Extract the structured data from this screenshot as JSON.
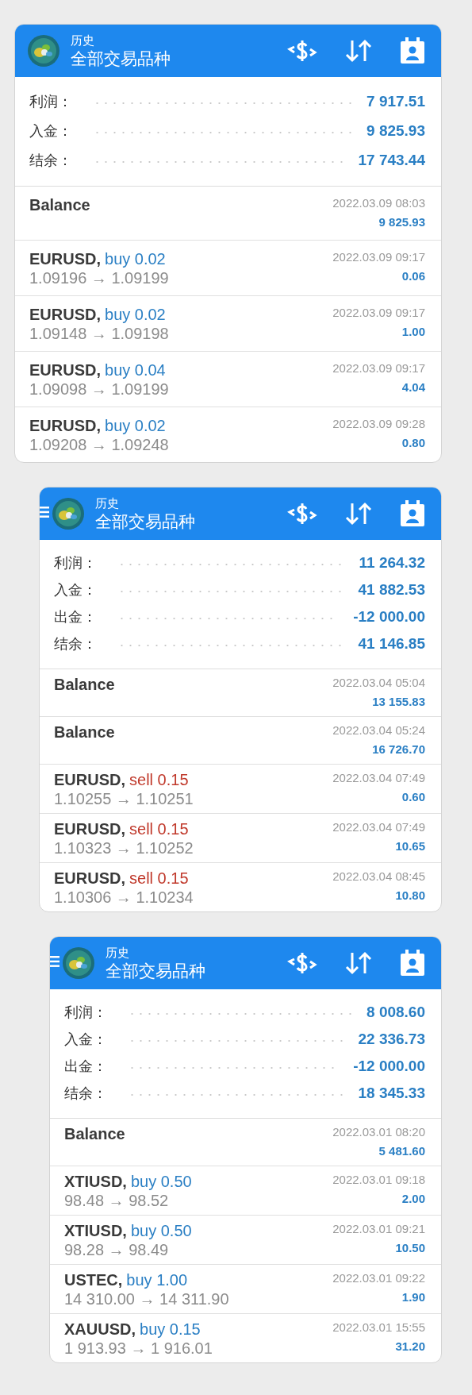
{
  "screens": [
    {
      "header": {
        "title": "历史",
        "subtitle": "全部交易品种",
        "menu_button": false
      },
      "summary": [
        {
          "label": "利润：",
          "value": "7 917.51"
        },
        {
          "label": "入金：",
          "value": "9 825.93"
        },
        {
          "label": "结余：",
          "value": "17 743.44"
        }
      ],
      "deals": [
        {
          "kind": "balance",
          "symbol": "Balance",
          "time": "2022.03.09 08:03",
          "profit": "9 825.93"
        },
        {
          "kind": "trade",
          "symbol": "EURUSD,",
          "side": "buy",
          "size": "0.02",
          "prices": "1.09196 → 1.09199",
          "time": "2022.03.09 09:17",
          "profit": "0.06"
        },
        {
          "kind": "trade",
          "symbol": "EURUSD,",
          "side": "buy",
          "size": "0.02",
          "prices": "1.09148 → 1.09198",
          "time": "2022.03.09 09:17",
          "profit": "1.00"
        },
        {
          "kind": "trade",
          "symbol": "EURUSD,",
          "side": "buy",
          "size": "0.04",
          "prices": "1.09098 → 1.09199",
          "time": "2022.03.09 09:17",
          "profit": "4.04"
        },
        {
          "kind": "trade",
          "symbol": "EURUSD,",
          "side": "buy",
          "size": "0.02",
          "prices": "1.09208 → 1.09248",
          "time": "2022.03.09 09:28",
          "profit": "0.80"
        }
      ]
    },
    {
      "header": {
        "title": "历史",
        "subtitle": "全部交易品种",
        "menu_button": true
      },
      "summary": [
        {
          "label": "利润：",
          "value": "11 264.32"
        },
        {
          "label": "入金：",
          "value": "41 882.53"
        },
        {
          "label": "出金：",
          "value": "-12 000.00"
        },
        {
          "label": "结余：",
          "value": "41 146.85"
        }
      ],
      "deals": [
        {
          "kind": "balance",
          "symbol": "Balance",
          "time": "2022.03.04 05:04",
          "profit": "13 155.83"
        },
        {
          "kind": "balance",
          "symbol": "Balance",
          "time": "2022.03.04 05:24",
          "profit": "16 726.70"
        },
        {
          "kind": "trade",
          "symbol": "EURUSD,",
          "side": "sell",
          "size": "0.15",
          "prices": "1.10255 → 1.10251",
          "time": "2022.03.04 07:49",
          "profit": "0.60"
        },
        {
          "kind": "trade",
          "symbol": "EURUSD,",
          "side": "sell",
          "size": "0.15",
          "prices": "1.10323 → 1.10252",
          "time": "2022.03.04 07:49",
          "profit": "10.65"
        },
        {
          "kind": "trade",
          "symbol": "EURUSD,",
          "side": "sell",
          "size": "0.15",
          "prices": "1.10306 → 1.10234",
          "time": "2022.03.04 08:45",
          "profit": "10.80"
        }
      ]
    },
    {
      "header": {
        "title": "历史",
        "subtitle": "全部交易品种",
        "menu_button": true
      },
      "summary": [
        {
          "label": "利润：",
          "value": "8 008.60"
        },
        {
          "label": "入金：",
          "value": "22 336.73"
        },
        {
          "label": "出金：",
          "value": "-12 000.00"
        },
        {
          "label": "结余：",
          "value": "18 345.33"
        }
      ],
      "deals": [
        {
          "kind": "balance",
          "symbol": "Balance",
          "time": "2022.03.01 08:20",
          "profit": "5 481.60"
        },
        {
          "kind": "trade",
          "symbol": "XTIUSD,",
          "side": "buy",
          "size": "0.50",
          "prices": "98.48 → 98.52",
          "time": "2022.03.01 09:18",
          "profit": "2.00"
        },
        {
          "kind": "trade",
          "symbol": "XTIUSD,",
          "side": "buy",
          "size": "0.50",
          "prices": "98.28 → 98.49",
          "time": "2022.03.01 09:21",
          "profit": "10.50"
        },
        {
          "kind": "trade",
          "symbol": "USTEC,",
          "side": "buy",
          "size": "1.00",
          "prices": "14 310.00 → 14 311.90",
          "time": "2022.03.01 09:22",
          "profit": "1.90"
        },
        {
          "kind": "trade",
          "symbol": "XAUUSD,",
          "side": "buy",
          "size": "0.15",
          "prices": "1 913.93 → 1 916.01",
          "time": "2022.03.01 15:55",
          "profit": "31.20"
        }
      ]
    }
  ]
}
